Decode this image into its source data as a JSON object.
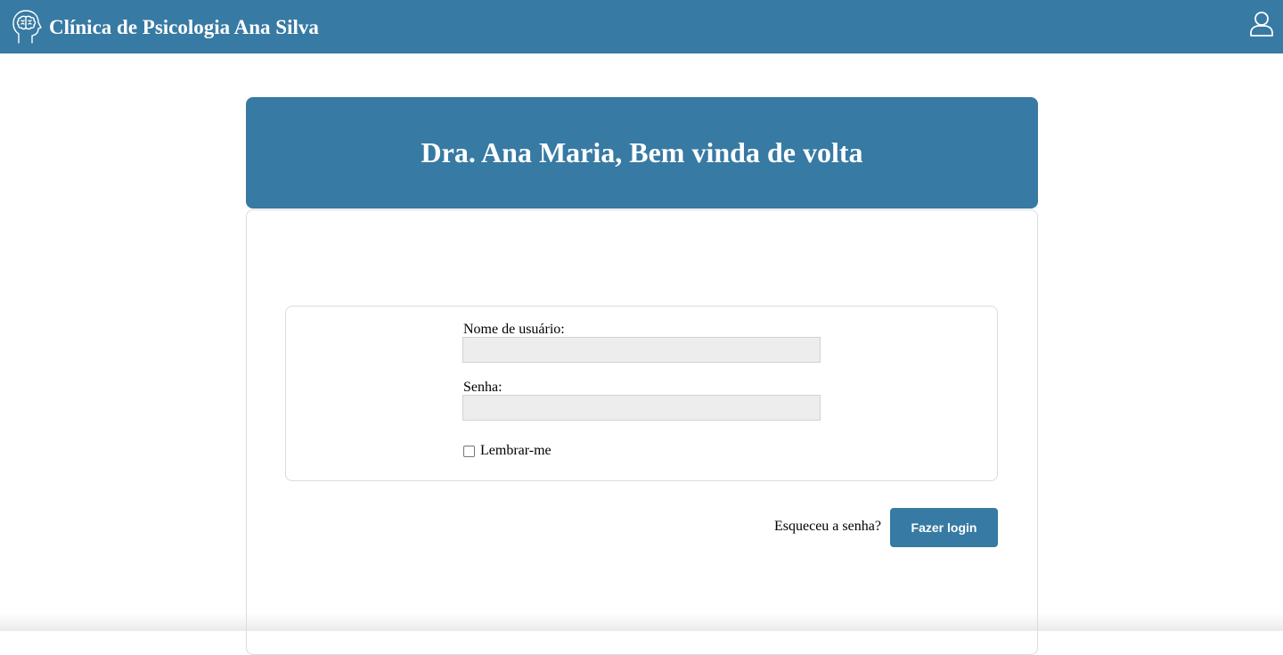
{
  "header": {
    "title": "Clínica de Psicologia Ana Silva",
    "logo_icon": "brain-head-icon",
    "user_icon": "user-icon",
    "background_color": "#377aa3"
  },
  "welcome": {
    "title": "Dra. Ana Maria, Bem vinda de volta"
  },
  "login_form": {
    "username_label": "Nome de usuário:",
    "username_value": "",
    "password_label": "Senha:",
    "password_value": "",
    "remember_label": "Lembrar-me",
    "remember_checked": false,
    "forgot_link": "Esqueceu a senha?",
    "submit_label": "Fazer login"
  },
  "colors": {
    "accent": "#377aa3",
    "input_background": "#ededed",
    "border": "#dcdcdc"
  }
}
